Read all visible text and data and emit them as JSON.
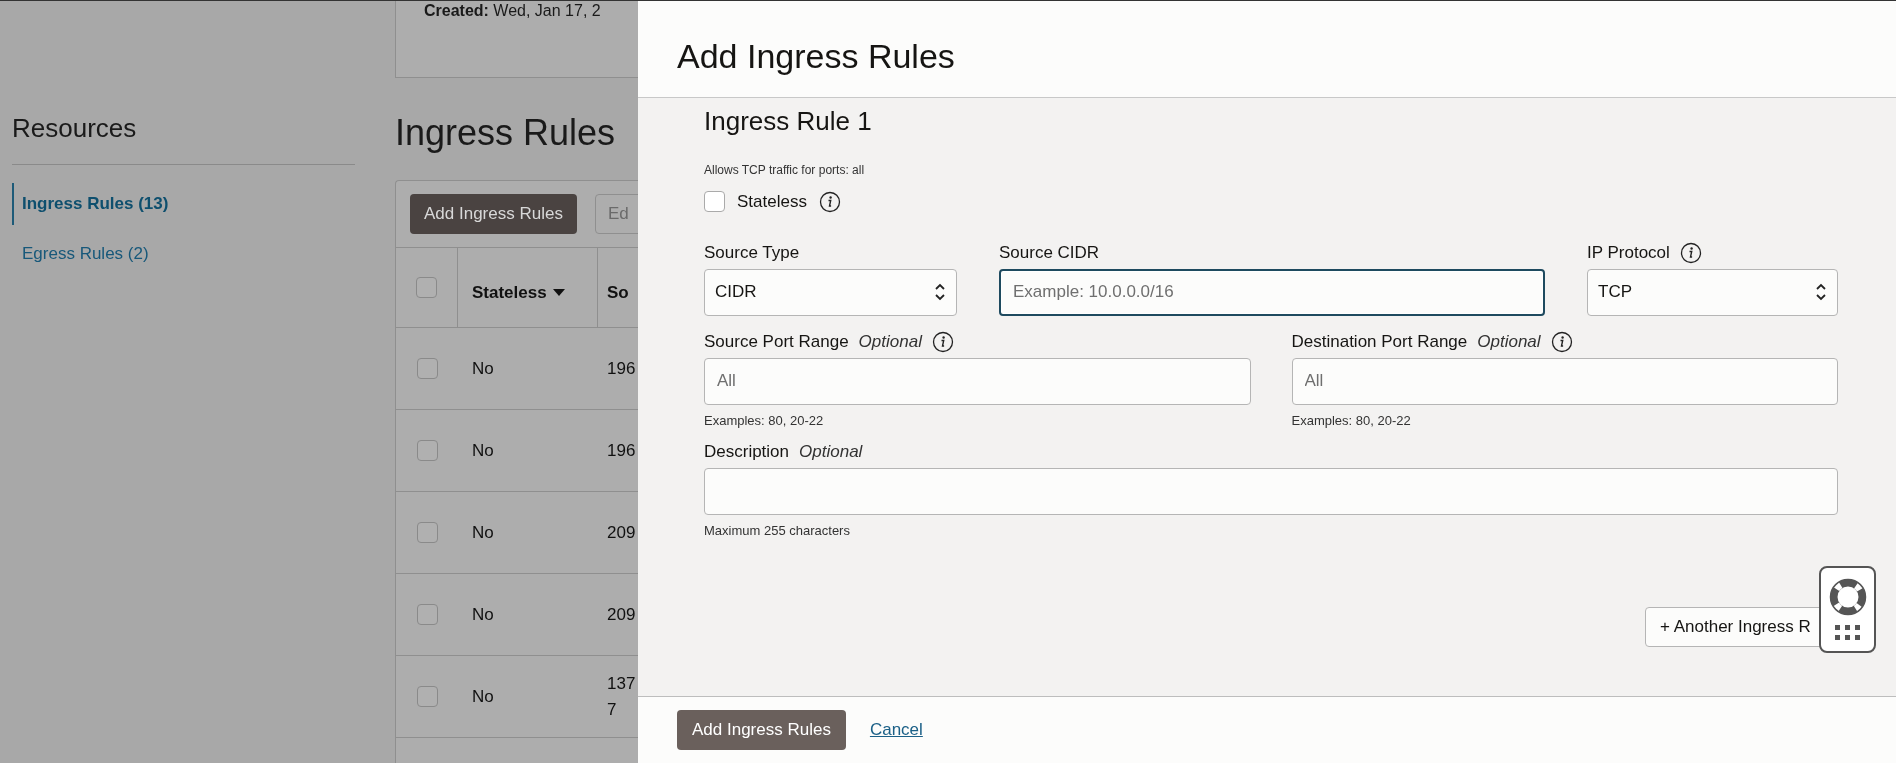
{
  "background": {
    "details_card": {
      "text": "**Created:** Wed, Jan 17, 2"
    },
    "resources_title": "Resources",
    "nav": [
      {
        "label": "Ingress Rules (13)",
        "selected": true
      },
      {
        "label": "Egress Rules (2)",
        "selected": false
      }
    ],
    "section_title": "Ingress Rules",
    "toolbar": [
      "Add Ingress Rules",
      "Ed"
    ],
    "table": {
      "header_checked": false,
      "columns": [
        "Stateless",
        "So"
      ],
      "rows": [
        {
          "checked": false,
          "stateless": "No",
          "source": "196"
        },
        {
          "checked": false,
          "stateless": "No",
          "source": "196"
        },
        {
          "checked": false,
          "stateless": "No",
          "source": "209"
        },
        {
          "checked": false,
          "stateless": "No",
          "source": "209"
        },
        {
          "checked": false,
          "stateless": "No",
          "source": "137\n7"
        }
      ]
    }
  },
  "dialog": {
    "title": "Add Ingress Rules",
    "rule": {
      "heading": "Ingress Rule 1",
      "summary": "Allows TCP traffic for ports: all",
      "stateless": {
        "label": "Stateless",
        "checked": false,
        "info": true
      },
      "field_rows": [
        [
          {
            "kind": "select",
            "label": "Source Type",
            "info": false,
            "value": "CIDR"
          },
          {
            "kind": "text",
            "label": "Source CIDR",
            "info": false,
            "placeholder": "Example: 10.0.0.0/16",
            "focused": true
          },
          {
            "kind": "select",
            "label": "IP Protocol",
            "info": true,
            "value": "TCP"
          }
        ],
        [
          {
            "kind": "text",
            "label": "Source Port Range",
            "optional": "Optional",
            "info": true,
            "placeholder": "All",
            "focused": false,
            "help": "Examples: 80, 20-22"
          },
          {
            "kind": "text",
            "label": "Destination Port Range",
            "optional": "Optional",
            "info": true,
            "placeholder": "All",
            "focused": false,
            "help": "Examples: 80, 20-22"
          }
        ],
        [
          {
            "kind": "text",
            "label": "Description",
            "optional": "Optional",
            "info": false,
            "focused": false,
            "help": "Maximum 255 characters"
          }
        ]
      ]
    },
    "another_button": "+ Another Ingress R",
    "footer": {
      "primary": "Add Ingress Rules",
      "cancel": "Cancel"
    }
  }
}
